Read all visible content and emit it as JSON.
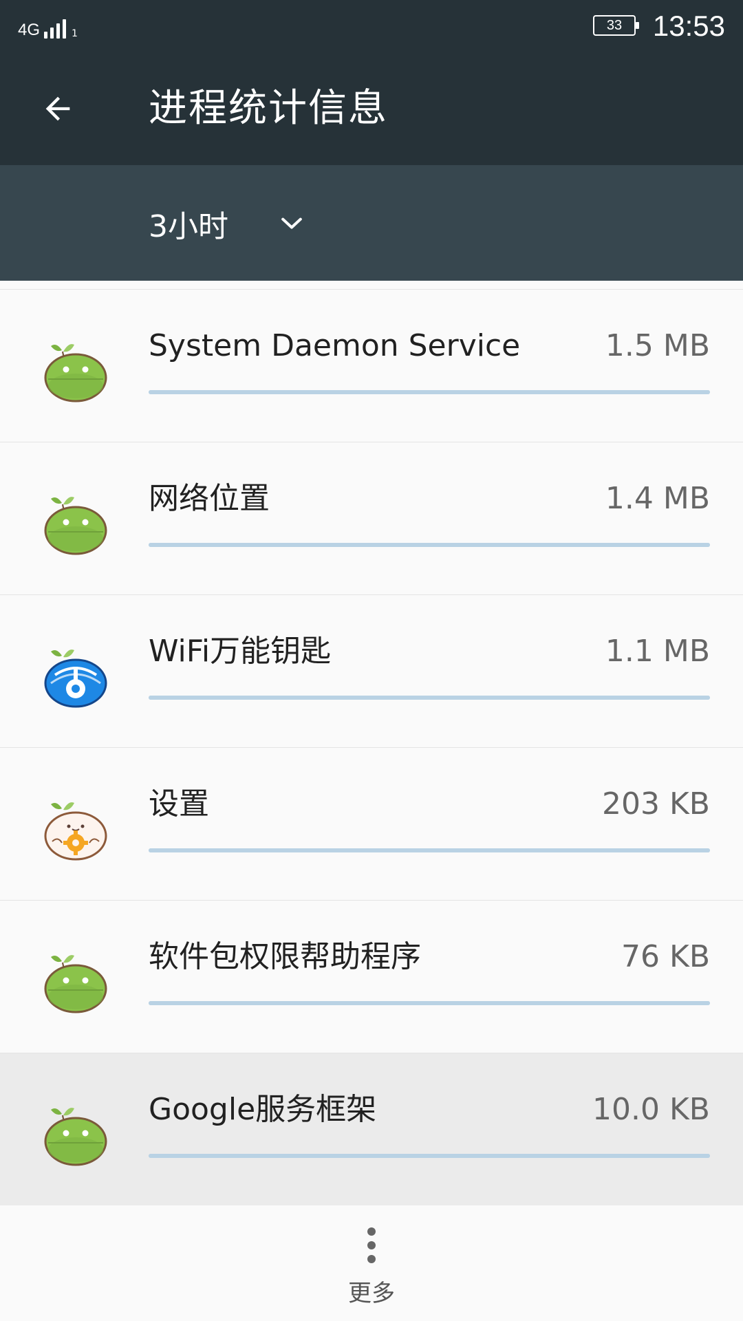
{
  "status_bar": {
    "network_label": "4G",
    "signal_sub": "1",
    "battery_level": "33",
    "time": "13:53"
  },
  "app_bar": {
    "title": "进程统计信息",
    "back_icon": "arrow-left-icon"
  },
  "filter": {
    "duration": "3小时",
    "dropdown_icon": "chevron-down-icon"
  },
  "processes": [
    {
      "name": "System Daemon Service",
      "size": "1.5 MB",
      "icon": "android-green-icon",
      "usage_fraction": 1.0
    },
    {
      "name": "网络位置",
      "size": "1.4 MB",
      "icon": "android-green-icon",
      "usage_fraction": 1.0
    },
    {
      "name": "WiFi万能钥匙",
      "size": "1.1 MB",
      "icon": "wifi-key-icon",
      "usage_fraction": 1.0
    },
    {
      "name": "设置",
      "size": "203 KB",
      "icon": "settings-gear-icon",
      "usage_fraction": 1.0
    },
    {
      "name": "软件包权限帮助程序",
      "size": "76 KB",
      "icon": "android-green-icon",
      "usage_fraction": 1.0
    },
    {
      "name": "Google服务框架",
      "size": "10.0 KB",
      "icon": "android-green-icon",
      "usage_fraction": 1.0
    }
  ],
  "footer": {
    "more_label": "更多",
    "more_icon": "more-vertical-icon"
  },
  "colors": {
    "status_bar_bg": "#263238",
    "filter_bar_bg": "#37474f",
    "list_bg": "#fafafa",
    "highlight_bg": "#ebebeb",
    "usage_bar": "#b9d2e4",
    "android_green": "#8bc34a"
  }
}
